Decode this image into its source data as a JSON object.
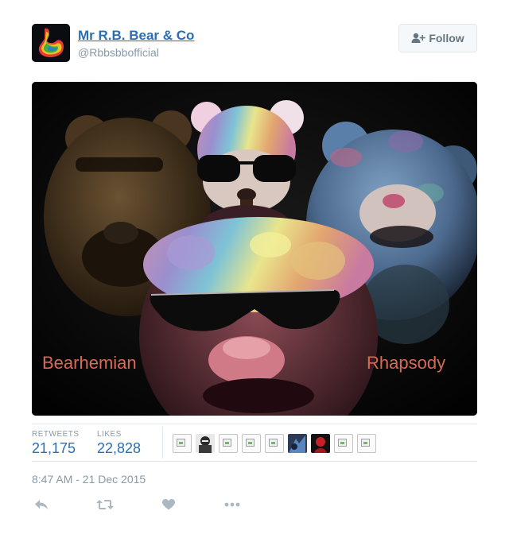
{
  "tweet": {
    "display_name": "Mr R.B. Bear & Co",
    "handle": "@Rbbsbbofficial",
    "follow_label": "Follow",
    "photo": {
      "caption_left": "Bearhemian",
      "caption_right": "Rhapsody"
    },
    "stats": {
      "retweets_label": "RETWEETS",
      "retweets_value": "21,175",
      "likes_label": "LIKES",
      "likes_value": "22,828"
    },
    "timestamp": "8:47 AM - 21 Dec 2015"
  },
  "colors": {
    "link_blue": "#2a6fb5",
    "muted_gray": "#8899a6",
    "caption_salmon": "#d86a55",
    "icon_gray": "#aab8c2"
  },
  "icons": {
    "reply": "reply-icon",
    "retweet": "retweet-icon",
    "like": "heart-icon",
    "more": "more-icon",
    "follow": "add-user-icon"
  }
}
